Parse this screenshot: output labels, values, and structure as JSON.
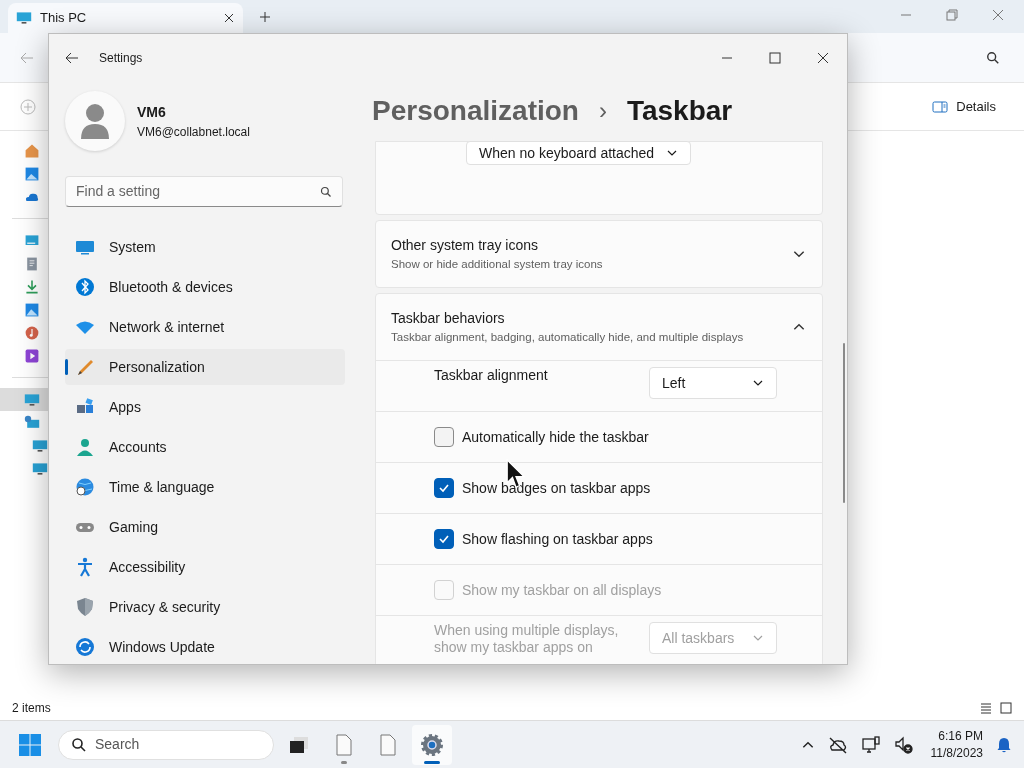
{
  "explorer": {
    "tab": {
      "title": "This PC",
      "selected": true
    },
    "command": "Details",
    "nav_items": [
      {
        "selected": false
      },
      {
        "selected": false
      },
      {
        "selected": false
      },
      {
        "selected": false
      },
      {
        "selected": false
      },
      {
        "selected": false
      },
      {
        "selected": false
      },
      {
        "selected": false
      },
      {
        "selected": false
      },
      {
        "selected": true
      },
      {
        "selected": false
      },
      {
        "selected": false
      },
      {
        "selected": false
      }
    ],
    "status": "2 items"
  },
  "settings": {
    "title": "Settings",
    "user": {
      "name": "VM6",
      "email": "VM6@collabnet.local"
    },
    "search": {
      "placeholder": "Find a setting"
    },
    "nav": [
      {
        "label": "System",
        "selected": false
      },
      {
        "label": "Bluetooth & devices",
        "selected": false
      },
      {
        "label": "Network & internet",
        "selected": false
      },
      {
        "label": "Personalization",
        "selected": true
      },
      {
        "label": "Apps",
        "selected": false
      },
      {
        "label": "Accounts",
        "selected": false
      },
      {
        "label": "Time & language",
        "selected": false
      },
      {
        "label": "Gaming",
        "selected": false
      },
      {
        "label": "Accessibility",
        "selected": false
      },
      {
        "label": "Privacy & security",
        "selected": false
      },
      {
        "label": "Windows Update",
        "selected": false
      }
    ],
    "breadcrumb": {
      "parent": "Personalization",
      "separator": "›",
      "current": "Taskbar"
    },
    "top_card": {
      "dropdown": "When no keyboard attached"
    },
    "sections": [
      {
        "title": "Other system tray icons",
        "subtitle": "Show or hide additional system tray icons",
        "expanded": false
      },
      {
        "title": "Taskbar behaviors",
        "subtitle": "Taskbar alignment, badging, automatically hide, and multiple displays",
        "expanded": true,
        "rows": [
          {
            "kind": "dropdown",
            "label": "Taskbar alignment",
            "value": "Left",
            "disabled": false
          },
          {
            "kind": "checkbox",
            "label": "Automatically hide the taskbar",
            "checked": false,
            "disabled": false
          },
          {
            "kind": "checkbox",
            "label": "Show badges on taskbar apps",
            "checked": true,
            "disabled": false
          },
          {
            "kind": "checkbox",
            "label": "Show flashing on taskbar apps",
            "checked": true,
            "disabled": false
          },
          {
            "kind": "checkbox",
            "label": "Show my taskbar on all displays",
            "checked": false,
            "disabled": true
          },
          {
            "kind": "dropdown",
            "label": "When using multiple displays, show my taskbar apps on",
            "value": "All taskbars",
            "disabled": true
          }
        ]
      }
    ]
  },
  "taskbar": {
    "search": {
      "placeholder": "Search"
    },
    "apps": [
      {
        "running": false,
        "active": false
      },
      {
        "running": true,
        "active": false
      },
      {
        "running": false,
        "active": false
      },
      {
        "running": true,
        "active": true
      }
    ],
    "time": "6:16 PM",
    "date": "11/8/2023"
  }
}
